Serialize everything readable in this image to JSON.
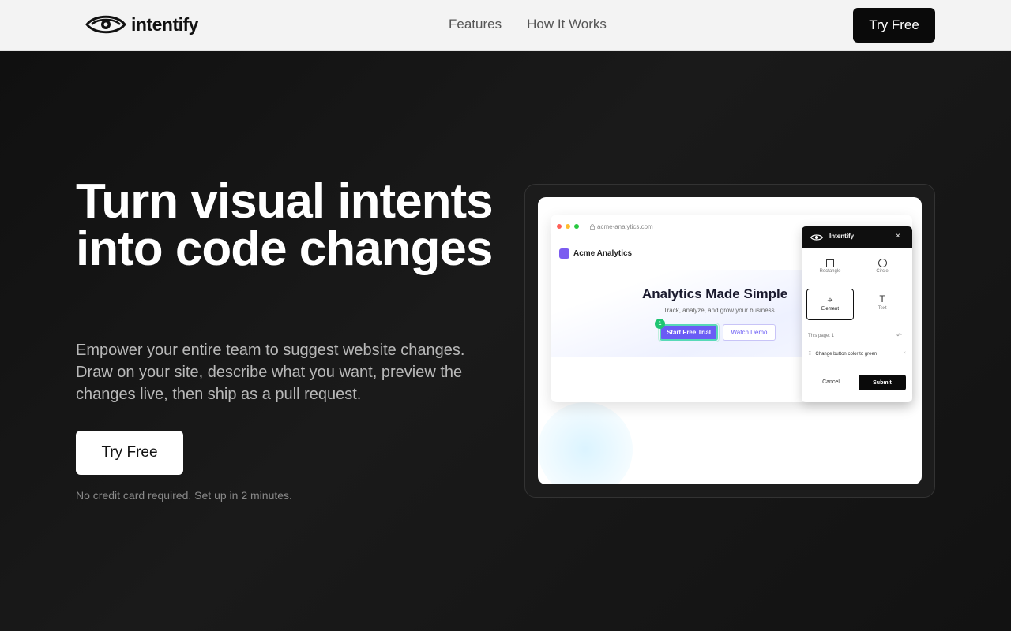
{
  "nav": {
    "logo_text": "intentify",
    "links": [
      {
        "label": "Features"
      },
      {
        "label": "How It Works"
      }
    ],
    "cta_label": "Try Free"
  },
  "hero": {
    "title": "Turn visual intents into code changes",
    "subtitle": "Empower your entire team to suggest website changes. Draw on your site, describe what you want, preview the changes live, then ship as a pull request.",
    "cta_label": "Try Free",
    "note": "No credit card required. Set up in 2 minutes."
  },
  "preview": {
    "url": "acme-analytics.com",
    "brand_name": "Acme Analytics",
    "site_title": "Analytics Made Simple",
    "site_subtitle": "Track, analyze, and grow your business",
    "primary_button": "Start Free Trial",
    "secondary_button": "Watch Demo",
    "marker_number": "1",
    "panel": {
      "title": "Intentify",
      "close_glyph": "×",
      "tools": [
        {
          "label": "Rectangle",
          "icon": "rectangle-icon"
        },
        {
          "label": "Circle",
          "icon": "circle-icon"
        },
        {
          "label": "Element",
          "icon": "crosshair-icon",
          "active": true
        },
        {
          "label": "Text",
          "icon": "text-icon"
        }
      ],
      "text_glyph": "T",
      "crosshair_glyph": "⌖",
      "page_count": "This page: 1",
      "undo_glyph": "↶",
      "change_grip": "⠿",
      "change_item": "Change button color to green",
      "change_remove": "×",
      "cancel_label": "Cancel",
      "submit_label": "Submit"
    }
  },
  "colors": {
    "accent": "#6a5cf5",
    "marker": "#1fc472",
    "dot_red": "#ff5f57",
    "dot_yellow": "#febc2e",
    "dot_green": "#28c840"
  }
}
